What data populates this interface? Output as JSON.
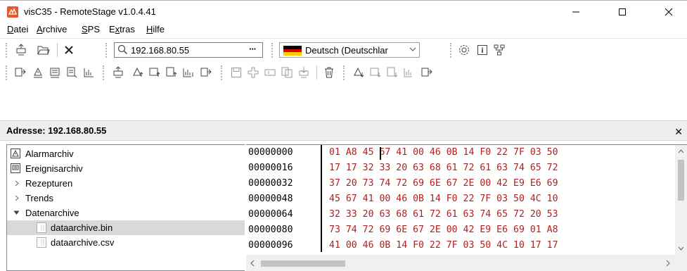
{
  "window": {
    "title": "visC35 - RemoteStage v1.0.4.41",
    "minimize_glyph": "—",
    "maximize_glyph": "☐",
    "close_glyph": "✕"
  },
  "menu": {
    "items": [
      {
        "label": "Datei",
        "underline": "D",
        "rest": "atei"
      },
      {
        "label": "Archive",
        "underline": "A",
        "rest": "rchive"
      },
      {
        "label": "SPS",
        "underline": "S",
        "rest": "PS"
      },
      {
        "label": "Extras",
        "underline": "x",
        "pre": "E",
        "rest": "tras"
      },
      {
        "label": "Hilfe",
        "underline": "H",
        "rest": "ilfe"
      }
    ]
  },
  "toolbar": {
    "address_value": "192.168.80.55",
    "address_more": "···",
    "language_value": "Deutsch (Deutschlar",
    "delete_glyph": "✕",
    "info_glyph": "i"
  },
  "panel": {
    "title": "Adresse: 192.168.80.55",
    "close_glyph": "✕"
  },
  "tree": {
    "items": [
      {
        "label": "Alarmarchiv",
        "icon": "alarm-archive-icon"
      },
      {
        "label": "Ereignisarchiv",
        "icon": "event-archive-icon"
      },
      {
        "label": "Rezepturen",
        "expander": "collapsed"
      },
      {
        "label": "Trends",
        "expander": "collapsed"
      },
      {
        "label": "Datenarchive",
        "expander": "expanded"
      },
      {
        "label": "dataarchive.bin",
        "icon": "file-icon",
        "selected": true
      },
      {
        "label": "dataarchive.csv",
        "icon": "file-icon"
      }
    ]
  },
  "hex": {
    "rows": [
      {
        "offset": "00000000",
        "bytes": "01 A8 45 67 41 00 46 0B 14 F0 22 7F 03 50"
      },
      {
        "offset": "00000016",
        "bytes": "17 17 32 33 20 63 68 61 72 61 63 74 65 72"
      },
      {
        "offset": "00000032",
        "bytes": "37 20 73 74 72 69 6E 67 2E 00 42 E9 E6 69"
      },
      {
        "offset": "00000048",
        "bytes": "45 67 41 00 46 0B 14 F0 22 7F 03 50 4C 10"
      },
      {
        "offset": "00000064",
        "bytes": "32 33 20 63 68 61 72 61 63 74 65 72 20 53"
      },
      {
        "offset": "00000080",
        "bytes": "73 74 72 69 6E 67 2E 00 42 E9 E6 69 01 A8"
      },
      {
        "offset": "00000096",
        "bytes": "41 00 46 0B 14 F0 22 7F 03 50 4C 10 17 17"
      }
    ]
  },
  "colors": {
    "hex_bytes": "#b02020",
    "app_icon": "#e8572a",
    "selection": "#d9d9d9"
  }
}
